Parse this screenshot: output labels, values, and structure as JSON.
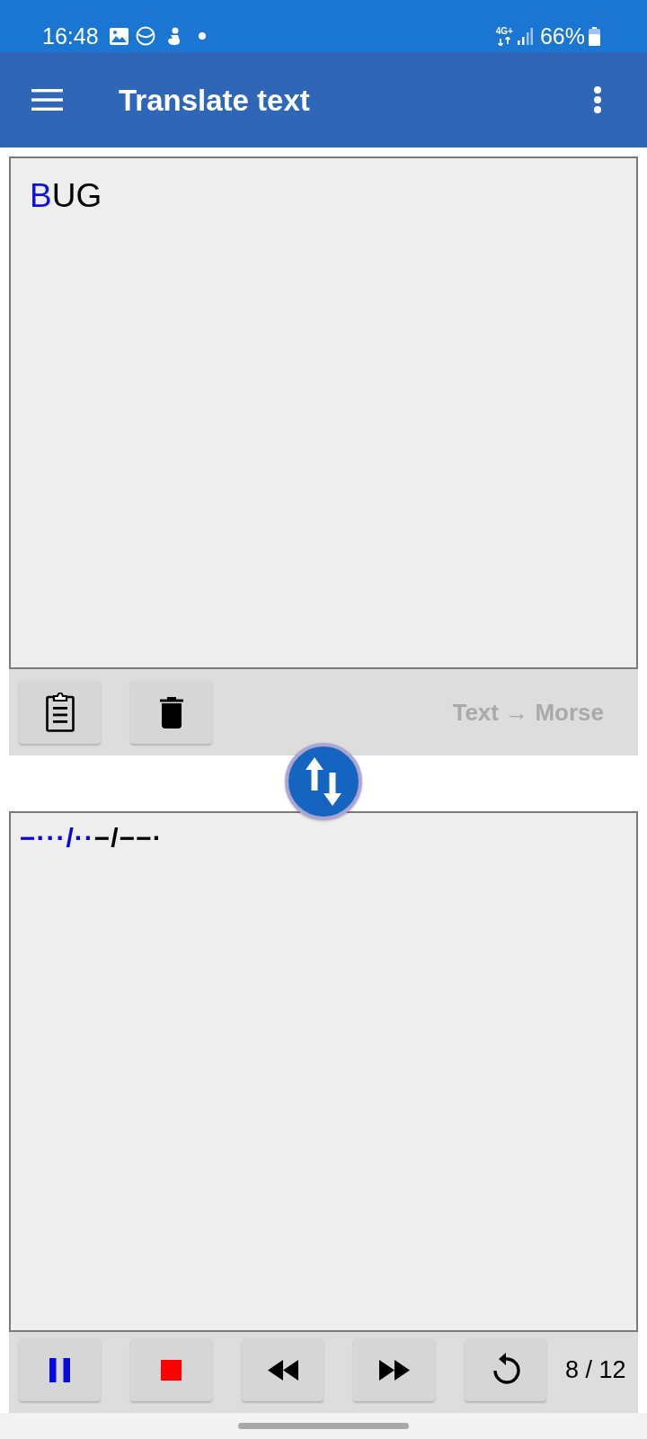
{
  "status_bar": {
    "time": "16:48",
    "network": "4G+",
    "battery": "66%"
  },
  "app_bar": {
    "title": "Translate text"
  },
  "input": {
    "segments": [
      {
        "text": "B",
        "highlighted": true
      },
      {
        "text": "UG",
        "highlighted": false
      }
    ]
  },
  "input_toolbar": {
    "direction": "Text → Morse"
  },
  "output": {
    "segments": [
      {
        "text": "−···/··",
        "highlighted": true
      },
      {
        "text": "−/−−·",
        "highlighted": false
      }
    ]
  },
  "player": {
    "playing": true,
    "counter": "8 / 12"
  }
}
